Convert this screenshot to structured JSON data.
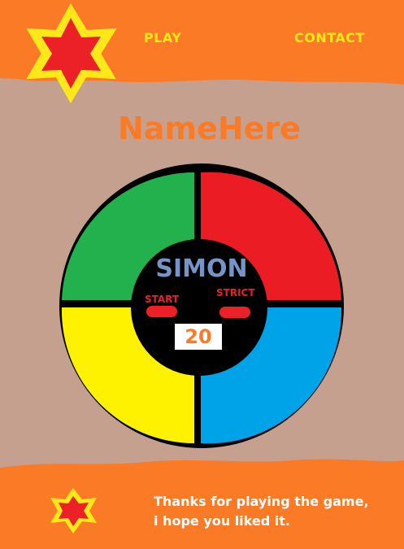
{
  "nav": {
    "play": "PLAY",
    "contact": "CONTACT"
  },
  "title": "NameHere",
  "game": {
    "name": "SIMON",
    "start_label": "START",
    "strict_label": "STRICT",
    "count": "20",
    "pads": [
      {
        "id": "green",
        "color": "#22b14c"
      },
      {
        "id": "red",
        "color": "#ec1c24"
      },
      {
        "id": "yellow",
        "color": "#fff200"
      },
      {
        "id": "blue",
        "color": "#00a2e8"
      }
    ]
  },
  "footer": {
    "line1": "Thanks for playing the game,",
    "line2": "i hope you liked it."
  },
  "colors": {
    "orange": "#fb7a26",
    "background": "#c5a08f",
    "star_red": "#ec2027",
    "star_yellow": "#ffe81a"
  }
}
